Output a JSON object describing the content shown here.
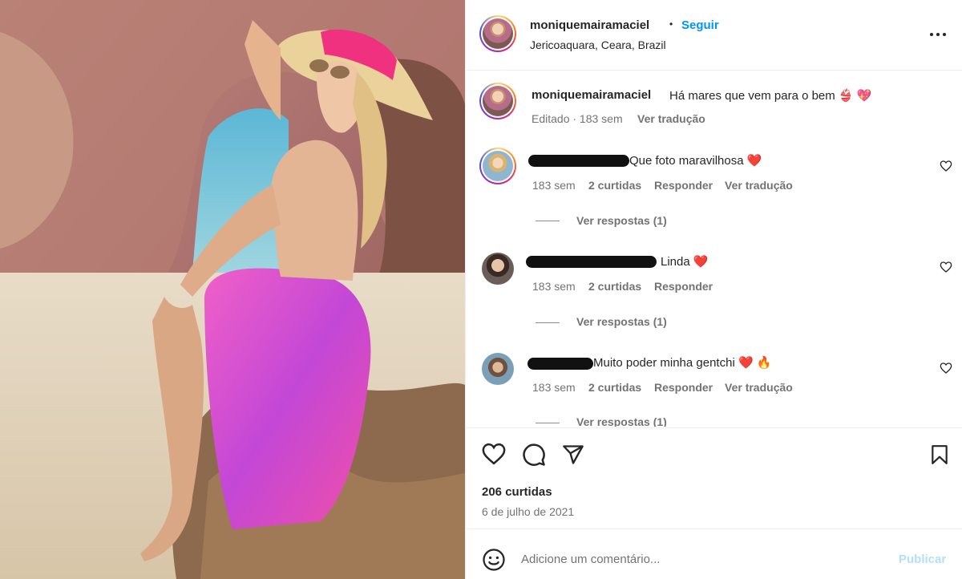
{
  "post": {
    "username": "moniquemairamaciel",
    "follow_label": "Seguir",
    "separator": "•",
    "location": "Jericoaquara, Ceara, Brazil"
  },
  "caption": {
    "username": "moniquemairamaciel",
    "text": "Há mares que vem para o bem 👙 💖",
    "edited": "Editado · 183 sem",
    "translate": "Ver tradução"
  },
  "comments": [
    {
      "text": "Que foto maravilhosa ❤️",
      "age": "183 sem",
      "likes": "2 curtidas",
      "reply": "Responder",
      "translate": "Ver tradução",
      "replies": "Ver respostas (1)"
    },
    {
      "text": "Linda ❤️",
      "age": "183 sem",
      "likes": "2 curtidas",
      "reply": "Responder",
      "translate": "",
      "replies": "Ver respostas (1)"
    },
    {
      "text": "Muito poder minha gentchi ❤️ 🔥",
      "age": "183 sem",
      "likes": "2 curtidas",
      "reply": "Responder",
      "translate": "Ver tradução",
      "replies": "Ver respostas (1)"
    }
  ],
  "stats": {
    "likes": "206 curtidas",
    "date": "6 de julho de 2021"
  },
  "add_comment": {
    "placeholder": "Adicione um comentário...",
    "publish": "Publicar"
  },
  "icons": {
    "more": "more-options-icon",
    "heart": "heart-icon",
    "comment": "comment-icon",
    "share": "share-icon",
    "save": "bookmark-icon",
    "emoji": "emoji-icon"
  },
  "colors": {
    "link": "#0095f6",
    "publish_disabled": "#b2dffc",
    "meta": "#737373"
  }
}
